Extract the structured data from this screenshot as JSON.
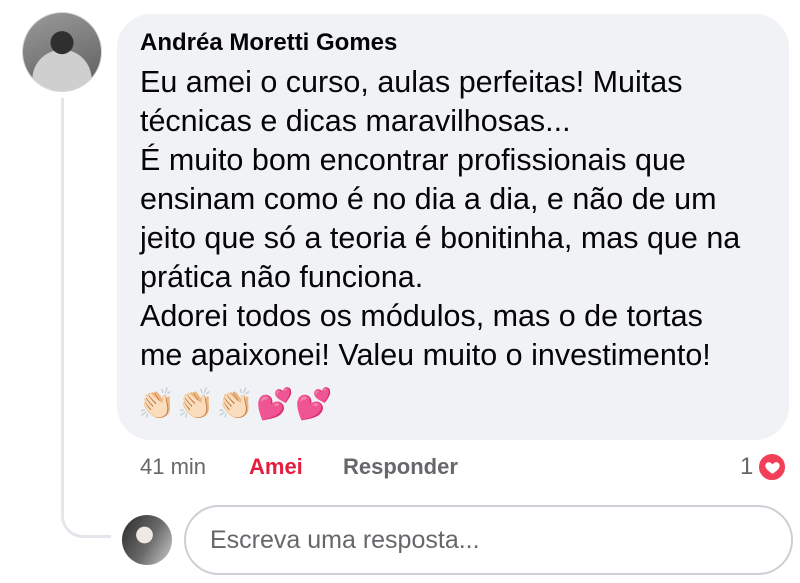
{
  "comment": {
    "author": "Andréa Moretti Gomes",
    "text": "Eu amei o curso, aulas perfeitas! Muitas\ntécnicas e dicas maravilhosas...\nÉ muito bom encontrar profissionais que\nensinam como é no dia a dia, e não de um\njeito que só a teoria é bonitinha, mas que na\nprática não funciona.\nAdorei todos os módulos,  mas o de tortas\nme apaixonei! Valeu muito o investimento!",
    "emojis": "👏🏻👏🏻👏🏻💕💕",
    "time": "41 min",
    "like_label": "Amei",
    "reply_label": "Responder",
    "reaction_count": "1",
    "reaction_icon": "heart-icon",
    "reaction_color": "#f33e58",
    "like_color": "#e41e3f"
  },
  "reply_box": {
    "placeholder": "Escreva uma resposta..."
  }
}
